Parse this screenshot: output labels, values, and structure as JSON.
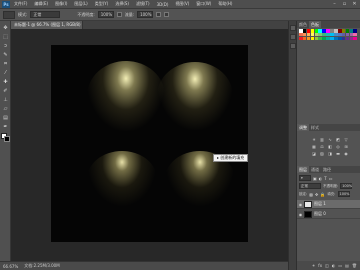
{
  "app": {
    "logo": "Ps"
  },
  "menubar": {
    "items": [
      "文件(F)",
      "编辑(E)",
      "图像(I)",
      "图层(L)",
      "类型(Y)",
      "选择(S)",
      "滤镜(T)",
      "3D(D)",
      "视图(V)",
      "窗口(W)",
      "帮助(H)"
    ],
    "window_controls": [
      "–",
      "▫",
      "✕"
    ]
  },
  "options": {
    "mode_label": "模式:",
    "mode_value": "正常",
    "opacity_label": "不透明度:",
    "opacity_value": "100%",
    "flow_label": "流量:",
    "flow_value": "100%"
  },
  "document": {
    "tab_title": "未标题-1 @ 66.7% (图层 1, RGB/8) *"
  },
  "status": {
    "zoom": "66.67%",
    "doc_info": "文档:2.25M/3.00M"
  },
  "tooltip": {
    "text": "▸ 创建新的填充"
  },
  "panels": {
    "color_tabs": [
      "颜色",
      "色板"
    ],
    "adjust_tabs": [
      "调整",
      "样式"
    ],
    "layers_tabs": [
      "图层",
      "通道",
      "路径"
    ],
    "blend_mode": "正常",
    "opacity_label": "不透明度:",
    "opacity_value": "100%",
    "lock_label": "锁定:",
    "fill_label": "填充:",
    "fill_value": "100%",
    "layers": [
      {
        "name": "图层 1",
        "selected": true,
        "thumb_color": "#e8e8e8"
      },
      {
        "name": "图层 0",
        "selected": false,
        "thumb_color": "#000000"
      }
    ],
    "footer_icons": [
      "⚭",
      "fx",
      "◫",
      "◐",
      "▭",
      "▤",
      "🗑"
    ]
  },
  "colors": {
    "swatches": [
      "#ffffff",
      "#000000",
      "#ff0000",
      "#ffff00",
      "#00ff00",
      "#00ffff",
      "#0000ff",
      "#ff00ff",
      "#808080",
      "#c0c0c0",
      "#800000",
      "#808000",
      "#008000",
      "#008080",
      "#000080",
      "#f26c4f",
      "#f68e56",
      "#fbaf5c",
      "#fff467",
      "#acd372",
      "#7cc576",
      "#3bb878",
      "#1abbb4",
      "#00bff3",
      "#438ccb",
      "#5574b9",
      "#605ca8",
      "#855fa8",
      "#a763a8",
      "#f06ea9",
      "#ed1c24",
      "#f26522",
      "#f7941d",
      "#fff200",
      "#8dc63f",
      "#39b54a",
      "#00a651",
      "#00a99d",
      "#00aeef",
      "#0072bc",
      "#0054a6",
      "#2e3192",
      "#662d91",
      "#92278f",
      "#ec008c"
    ]
  }
}
